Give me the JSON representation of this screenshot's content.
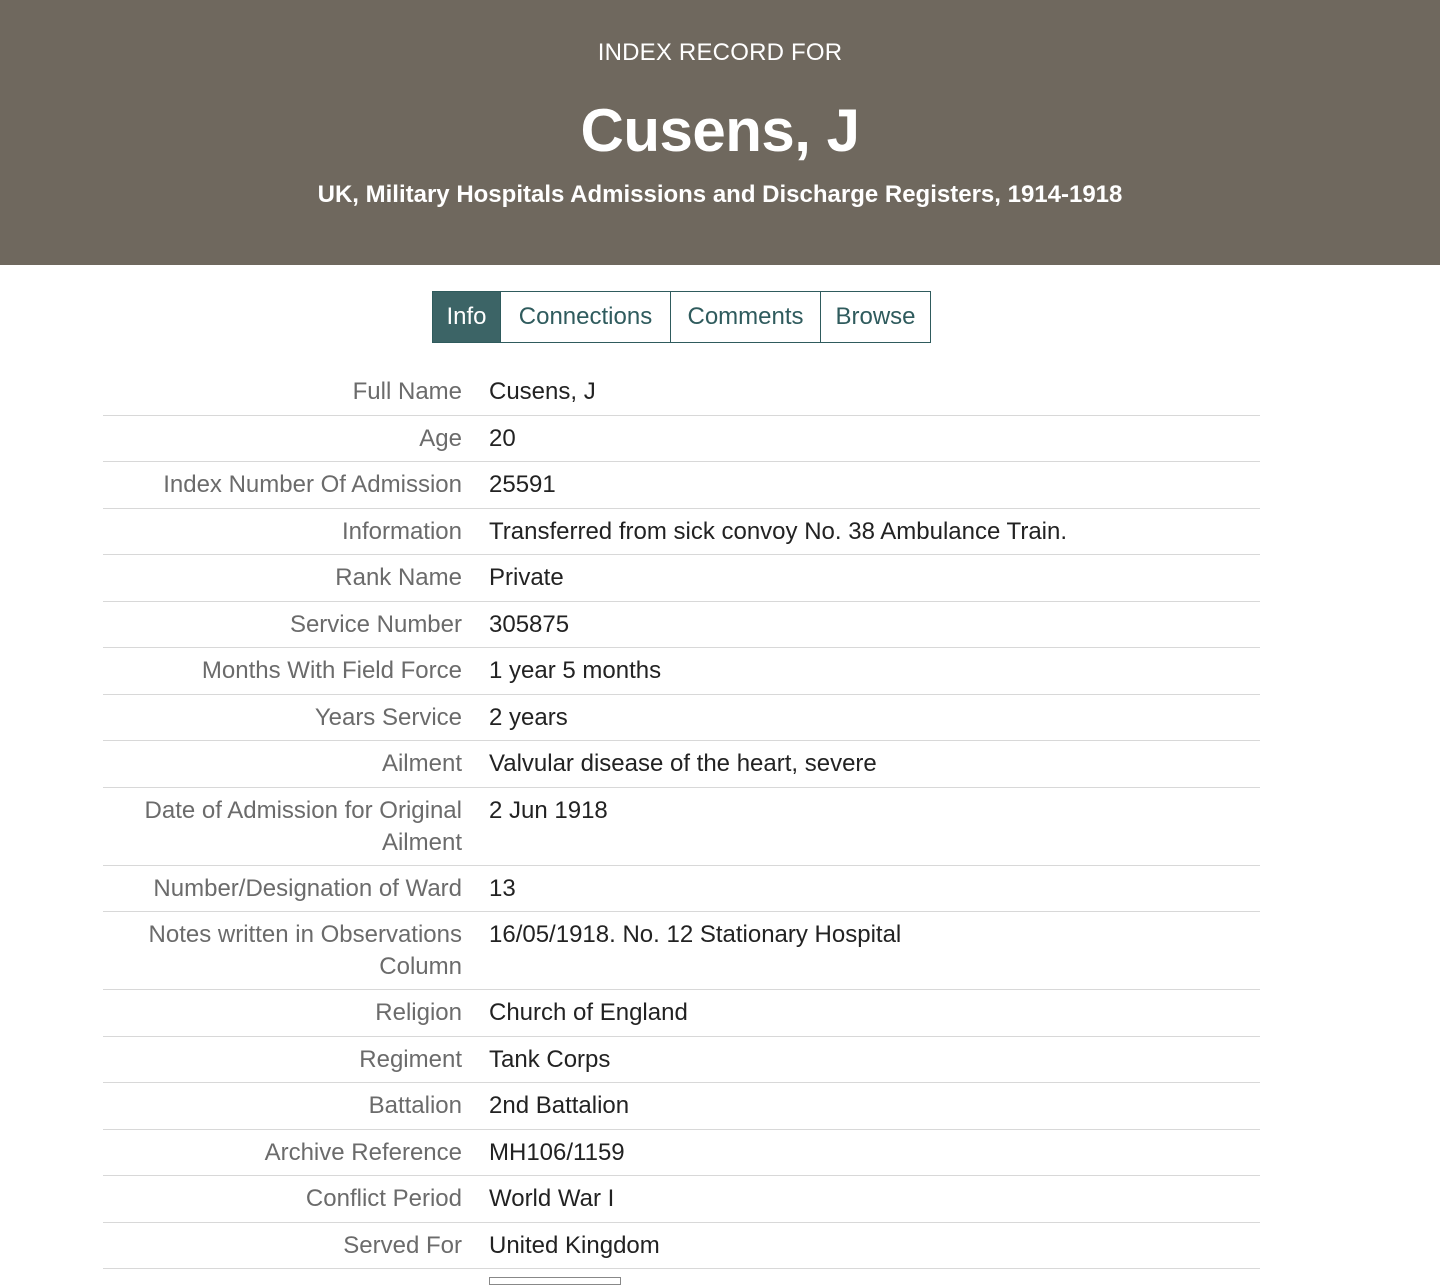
{
  "header": {
    "eyebrow": "INDEX RECORD FOR",
    "title": "Cusens, J",
    "subtitle": "UK, Military Hospitals Admissions and Discharge Registers, 1914-1918"
  },
  "tabs": [
    {
      "label": "Info",
      "active": true
    },
    {
      "label": "Connections",
      "active": false
    },
    {
      "label": "Comments",
      "active": false
    },
    {
      "label": "Browse",
      "active": false
    }
  ],
  "fields": [
    {
      "label": "Full Name",
      "value": "Cusens, J"
    },
    {
      "label": "Age",
      "value": "20"
    },
    {
      "label": "Index Number Of Admission",
      "value": "25591"
    },
    {
      "label": "Information",
      "value": "Transferred from sick convoy No. 38 Ambulance Train."
    },
    {
      "label": "Rank Name",
      "value": "Private"
    },
    {
      "label": "Service Number",
      "value": "305875"
    },
    {
      "label": "Months With Field Force",
      "value": "1 year 5 months"
    },
    {
      "label": "Years Service",
      "value": "2 years"
    },
    {
      "label": "Ailment",
      "value": "Valvular disease of the heart, severe"
    },
    {
      "label": "Date of Admission for Original Ailment",
      "value": "2 Jun 1918"
    },
    {
      "label": "Number/Designation of Ward",
      "value": "13"
    },
    {
      "label": "Notes written in Observations Column",
      "value": "16/05/1918. No. 12 Stationary Hospital"
    },
    {
      "label": "Religion",
      "value": "Church of England"
    },
    {
      "label": "Regiment",
      "value": "Tank Corps"
    },
    {
      "label": "Battalion",
      "value": "2nd Battalion"
    },
    {
      "label": "Archive Reference",
      "value": "MH106/1159"
    },
    {
      "label": "Conflict Period",
      "value": "World War I"
    },
    {
      "label": "Served For",
      "value": "United Kingdom"
    }
  ],
  "colors": {
    "header_bg": "#6f685e",
    "tab_active_bg": "#3c6466",
    "tab_border": "#2f5b5d"
  }
}
